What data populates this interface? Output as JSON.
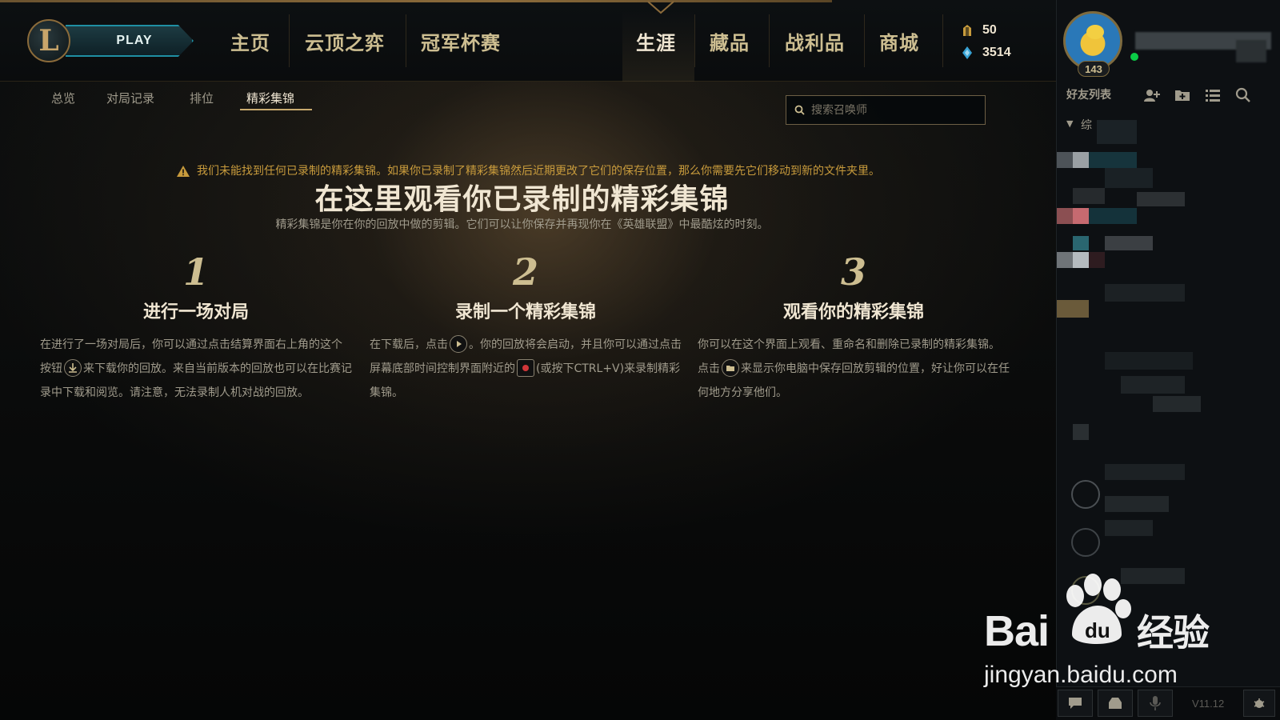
{
  "topbar": {
    "play_label": "PLAY",
    "nav": {
      "home": "主页",
      "tft": "云顶之弈",
      "clash": "冠军杯赛",
      "career": "生涯",
      "collection": "藏品",
      "loot": "战利品",
      "store": "商城"
    },
    "currency": {
      "rp": "50",
      "be": "3514"
    }
  },
  "subnav": {
    "overview": "总览",
    "match_history": "对局记录",
    "ranked": "排位",
    "highlights": "精彩集锦"
  },
  "search": {
    "placeholder": "搜索召唤师"
  },
  "content": {
    "warning": "我们未能找到任何已录制的精彩集锦。如果你已录制了精彩集锦然后近期更改了它们的保存位置，那么你需要先它们移动到新的文件夹里。",
    "headline": "在这里观看你已录制的精彩集锦",
    "subline": "精彩集锦是你在你的回放中做的剪辑。它们可以让你保存并再现你在《英雄联盟》中最酷炫的时刻。",
    "steps": [
      {
        "num": "1",
        "title": "进行一场对局",
        "text_a": "在进行了一场对局后，你可以通过点击结算界面右上角的这个按钮",
        "text_b": "来下载你的回放。来自当前版本的回放也可以在比赛记录中下载和阅览。请注意，无法录制人机对战的回放。"
      },
      {
        "num": "2",
        "title": "录制一个精彩集锦",
        "text_a": "在下载后，点击",
        "text_b": "。你的回放将会启动，并且你可以通过点击屏幕底部时间控制界面附近的",
        "text_c": "(或按下CTRL+V)来录制精彩集锦。"
      },
      {
        "num": "3",
        "title": "观看你的精彩集锦",
        "text_a": "你可以在这个界面上观看、重命名和删除已录制的精彩集锦。点击",
        "text_b": "来显示你电脑中保存回放剪辑的位置，好让你可以在任何地方分享他们。"
      }
    ]
  },
  "social": {
    "level": "143",
    "friends_header": "好友列表",
    "group_label": "综",
    "version": "V11.12"
  },
  "watermark": {
    "line1": "Bai",
    "line1b": "经验",
    "line2": "jingyan.baidu.com"
  },
  "colors": {
    "gold": "#c8aa6e",
    "teal": "#1f8fa3",
    "text": "#a09b8c",
    "warning": "#c89b3c",
    "online": "#0acb46"
  }
}
